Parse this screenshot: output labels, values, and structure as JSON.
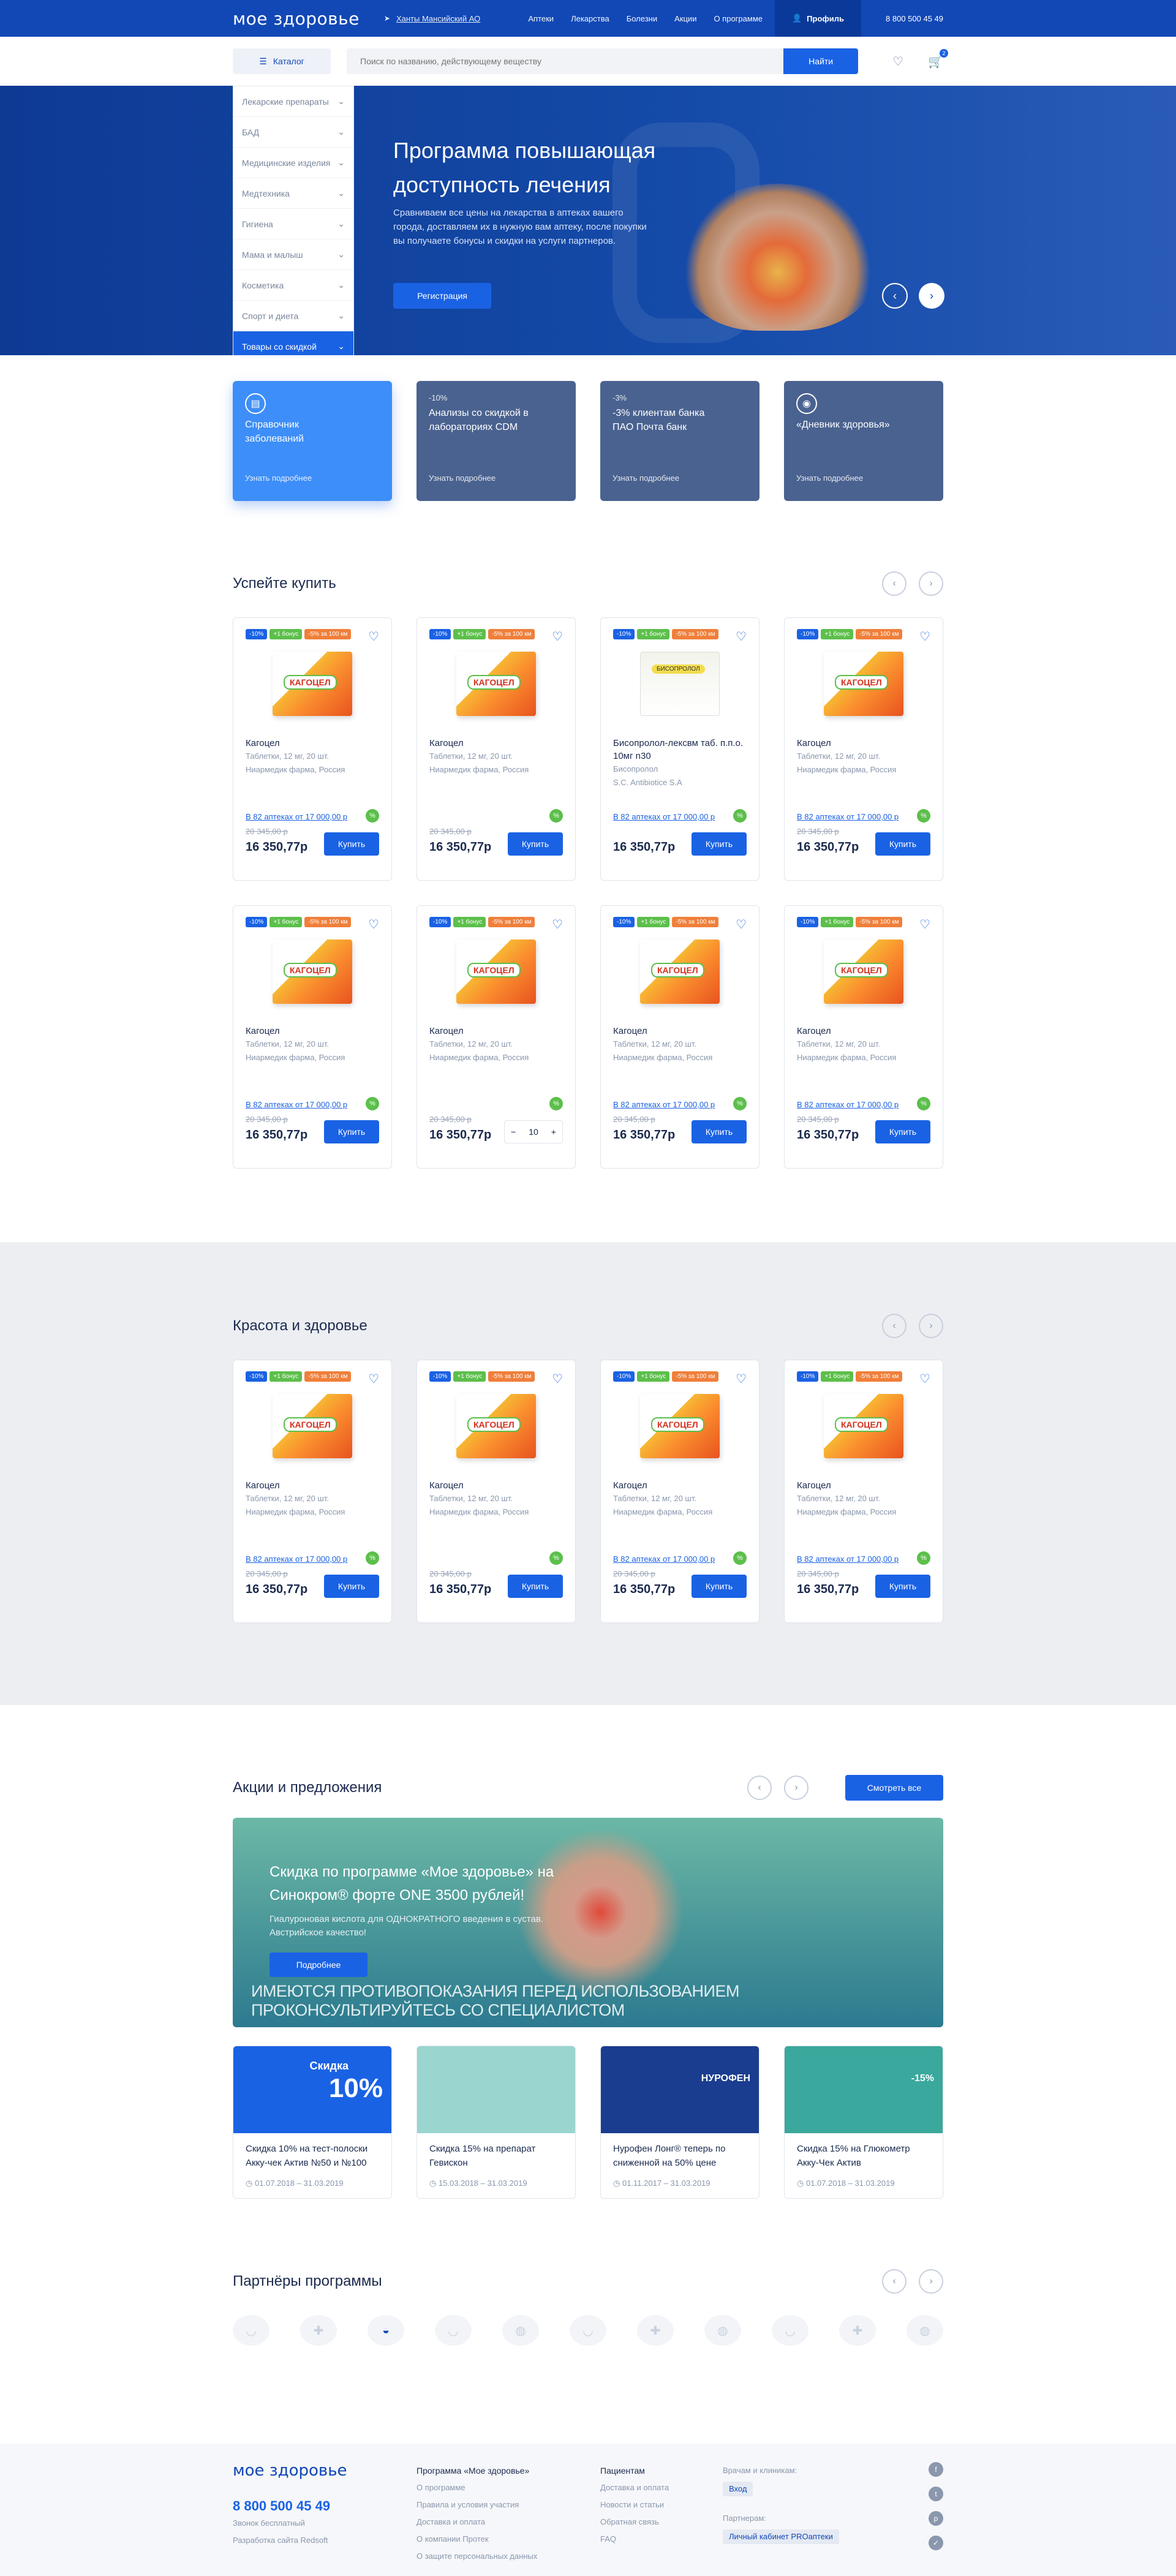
{
  "topbar": {
    "logo": "мое здоровье",
    "city": "Ханты Мансийский АО",
    "nav": [
      "Аптеки",
      "Лекарства",
      "Болезни",
      "Акции",
      "О программе"
    ],
    "profile": "Профиль",
    "phone": "8 800 500 45 49"
  },
  "search": {
    "catalog": "Каталог",
    "placeholder": "Поиск по названию, действующему веществу",
    "button": "Найти",
    "cart_count": "2"
  },
  "sidebar": {
    "items": [
      "Лекарские препараты",
      "БАД",
      "Медицинские изделия",
      "Медтехника",
      "Гигиена",
      "Мама и малыш",
      "Косметика",
      "Спорт и диета",
      "Товары со скидкой"
    ]
  },
  "hero": {
    "title": "Программа повышающая доступность лечения",
    "text": "Сравниваем все цены на лекарства в аптеках вашего города, доставляем их в нужную вам аптеку, после покупки вы получаете бонусы и скидки на услуги партнеров.",
    "button": "Регистрация"
  },
  "promos": [
    {
      "disc": "",
      "title": "Справочник заболеваний",
      "more": "Узнать подробнее"
    },
    {
      "disc": "-10%",
      "title": "Анализы со скидкой в лабораториях CDM",
      "more": "Узнать подробнее"
    },
    {
      "disc": "-3%",
      "title": "-3% клиентам банка ПАО Почта банк",
      "more": "Узнать подробнее"
    },
    {
      "disc": "",
      "title": "«Дневник здоровья»",
      "more": "Узнать подробнее"
    }
  ],
  "sections": {
    "hurry": "Успейте купить",
    "beauty": "Красота и здоровье",
    "actions": "Акции и предложения",
    "partners": "Партнёры программы",
    "see_all": "Смотреть все"
  },
  "tags": {
    "t1": "-10%",
    "t2": "+1 бонус",
    "t3": "-5% за 100 км"
  },
  "products": [
    {
      "name": "Кагоцел",
      "sub1": "Таблетки, 12 мг, 20 шт.",
      "sub2": "Ниармедик фарма, Россия",
      "avail": "В 82 аптеках от 17 000,00 р",
      "old": "20 345,00 р",
      "price": "16 350,77р",
      "buy": "Купить"
    },
    {
      "name": "Кагоцел",
      "sub1": "Таблетки, 12 мг, 20 шт.",
      "sub2": "Ниармедик фарма, Россия",
      "avail": "",
      "old": "20 345,00 р",
      "price": "16 350,77р",
      "buy": "Купить"
    },
    {
      "name": "Бисопролол-лексвм таб. п.п.о. 10мг n30",
      "sub1": "Бисопролол",
      "sub2": "S.C. Antibiotice S.A",
      "avail": "В 82 аптеках от 17 000,00 р",
      "old": "",
      "price": "16 350,77р",
      "buy": "Купить"
    },
    {
      "name": "Кагоцел",
      "sub1": "Таблетки, 12 мг, 20 шт.",
      "sub2": "Ниармедик фарма, Россия",
      "avail": "В 82 аптеках от 17 000,00 р",
      "old": "20 345,00 р",
      "price": "16 350,77р",
      "buy": "Купить"
    }
  ],
  "box_label": "КАГОЦЕЛ",
  "box_label2": "БИСОПРОЛОЛ",
  "qty": "10",
  "banner": {
    "title": "Скидка по программе «Мое здоровье» на Синокром® форте ONE 3500 рублей!",
    "text": "Гиалуроновая кислота для ОДНОКРАТНОГО введения в сустав. Австрийское качество!",
    "button": "Подробнее",
    "warning": "ИМЕЮТСЯ ПРОТИВОПОКАЗАНИЯ ПЕРЕД ИСПОЛЬЗОВАНИЕМ ПРОКОНСУЛЬТИРУЙТЕСЬ СО СПЕЦИАЛИСТОМ"
  },
  "news": [
    {
      "title": "Скидка 10% на тест-полоски Акку-чек Актив №50 и №100",
      "date": "01.07.2018 – 31.03.2019",
      "img_a": "Скидка",
      "img_b": "10%",
      "color": "#1a62e4"
    },
    {
      "title": "Скидка 15% на препарат Гевискон",
      "date": "15.03.2018 – 31.03.2019",
      "img_a": "",
      "img_b": "",
      "color": "#9ad6cf"
    },
    {
      "title": "Нурофен Лонг® теперь по сниженной на 50% цене",
      "date": "01.11.2017 – 31.03.2019",
      "img_a": "",
      "img_b": "НУРОФЕН",
      "color": "#1a3d8f"
    },
    {
      "title": "Скидка 15% на Глюкометр Акку-Чек Актив",
      "date": "01.07.2018 – 31.03.2019",
      "img_a": "",
      "img_b": "-15%",
      "color": "#3aa89c"
    }
  ],
  "footer": {
    "logo": "мое здоровье",
    "phone": "8 800 500 45 49",
    "free": "Звонок бесплатный",
    "dev": "Разработка сайта Redsoft",
    "col1_title": "Программа «Мое здоровье»",
    "col1": [
      "О программе",
      "Правила и условия участия",
      "Доставка и оплата",
      "О компании Протек",
      "О защите персональных данных"
    ],
    "col2_title": "Пациентам",
    "col2": [
      "Доставка и оплата",
      "Новости и статьи",
      "Обратная связь",
      "FAQ"
    ],
    "doctors": "Врачам и клиникам:",
    "login": "Вход",
    "partners": "Партнерам:",
    "cabinet": "Личный кабинет PROаптеки"
  }
}
